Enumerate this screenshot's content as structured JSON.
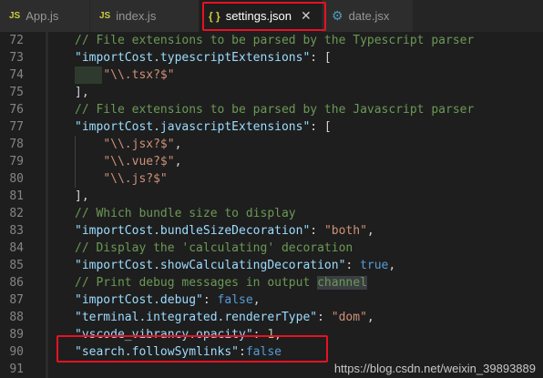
{
  "tabs": [
    {
      "icon": "JS",
      "label": "App.js"
    },
    {
      "icon": "JS",
      "label": "index.js"
    },
    {
      "icon": "{ }",
      "label": "settings.json",
      "close": "✕"
    },
    {
      "icon": "⚙",
      "label": "date.jsx"
    }
  ],
  "lines": [
    {
      "n": "72",
      "parts": [
        {
          "t": "// File extensions to be parsed by the Typescript parser",
          "c": "cmt"
        }
      ]
    },
    {
      "n": "73",
      "parts": [
        {
          "t": "\"importCost.typescriptExtensions\"",
          "c": "key"
        },
        {
          "t": ": [",
          "c": "pun"
        }
      ]
    },
    {
      "n": "74",
      "parts": [
        {
          "t": "    ",
          "c": "pun"
        },
        {
          "t": "\"\\\\.tsx?$\"",
          "c": "str"
        }
      ]
    },
    {
      "n": "75",
      "parts": [
        {
          "t": "],",
          "c": "pun"
        }
      ]
    },
    {
      "n": "76",
      "parts": [
        {
          "t": "// File extensions to be parsed by the Javascript parser",
          "c": "cmt"
        }
      ]
    },
    {
      "n": "77",
      "parts": [
        {
          "t": "\"importCost.javascriptExtensions\"",
          "c": "key"
        },
        {
          "t": ": [",
          "c": "pun"
        }
      ]
    },
    {
      "n": "78",
      "parts": [
        {
          "t": "    ",
          "c": "pun"
        },
        {
          "t": "\"\\\\.jsx?$\"",
          "c": "str"
        },
        {
          "t": ",",
          "c": "pun"
        }
      ]
    },
    {
      "n": "79",
      "parts": [
        {
          "t": "    ",
          "c": "pun"
        },
        {
          "t": "\"\\\\.vue?$\"",
          "c": "str"
        },
        {
          "t": ",",
          "c": "pun"
        }
      ]
    },
    {
      "n": "80",
      "parts": [
        {
          "t": "    ",
          "c": "pun"
        },
        {
          "t": "\"\\\\.js?$\"",
          "c": "str"
        }
      ]
    },
    {
      "n": "81",
      "parts": [
        {
          "t": "],",
          "c": "pun"
        }
      ]
    },
    {
      "n": "82",
      "parts": [
        {
          "t": "// Which bundle size to display",
          "c": "cmt"
        }
      ]
    },
    {
      "n": "83",
      "parts": [
        {
          "t": "\"importCost.bundleSizeDecoration\"",
          "c": "key"
        },
        {
          "t": ": ",
          "c": "pun"
        },
        {
          "t": "\"both\"",
          "c": "str"
        },
        {
          "t": ",",
          "c": "pun"
        }
      ]
    },
    {
      "n": "84",
      "parts": [
        {
          "t": "// Display the 'calculating' decoration",
          "c": "cmt"
        }
      ]
    },
    {
      "n": "85",
      "parts": [
        {
          "t": "\"importCost.showCalculatingDecoration\"",
          "c": "key"
        },
        {
          "t": ": ",
          "c": "pun"
        },
        {
          "t": "true",
          "c": "kw"
        },
        {
          "t": ",",
          "c": "pun"
        }
      ]
    },
    {
      "n": "86",
      "parts": [
        {
          "t": "// Print debug messages in output ",
          "c": "cmt"
        },
        {
          "t": "channel",
          "c": "cmt chan"
        }
      ]
    },
    {
      "n": "87",
      "parts": [
        {
          "t": "\"importCost.debug\"",
          "c": "key"
        },
        {
          "t": ": ",
          "c": "pun"
        },
        {
          "t": "false",
          "c": "kw"
        },
        {
          "t": ",",
          "c": "pun"
        }
      ]
    },
    {
      "n": "88",
      "parts": [
        {
          "t": "\"terminal.integrated.rendererType\"",
          "c": "key"
        },
        {
          "t": ": ",
          "c": "pun"
        },
        {
          "t": "\"dom\"",
          "c": "str"
        },
        {
          "t": ",",
          "c": "pun"
        }
      ]
    },
    {
      "n": "89",
      "parts": [
        {
          "t": "\"vscode_vibrancy.opacity\"",
          "c": "key"
        },
        {
          "t": ": ",
          "c": "pun"
        },
        {
          "t": "1",
          "c": "num"
        },
        {
          "t": ",",
          "c": "pun"
        }
      ]
    },
    {
      "n": "90",
      "parts": [
        {
          "t": "\"search.followSymlinks\"",
          "c": "key"
        },
        {
          "t": ":",
          "c": "pun"
        },
        {
          "t": "false",
          "c": "kw"
        }
      ]
    },
    {
      "n": "91",
      "parts": []
    }
  ],
  "watermark": "https://blog.csdn.net/weixin_39893889",
  "colors": {
    "highlight": "#e81123",
    "background": "#1e1e1e"
  }
}
